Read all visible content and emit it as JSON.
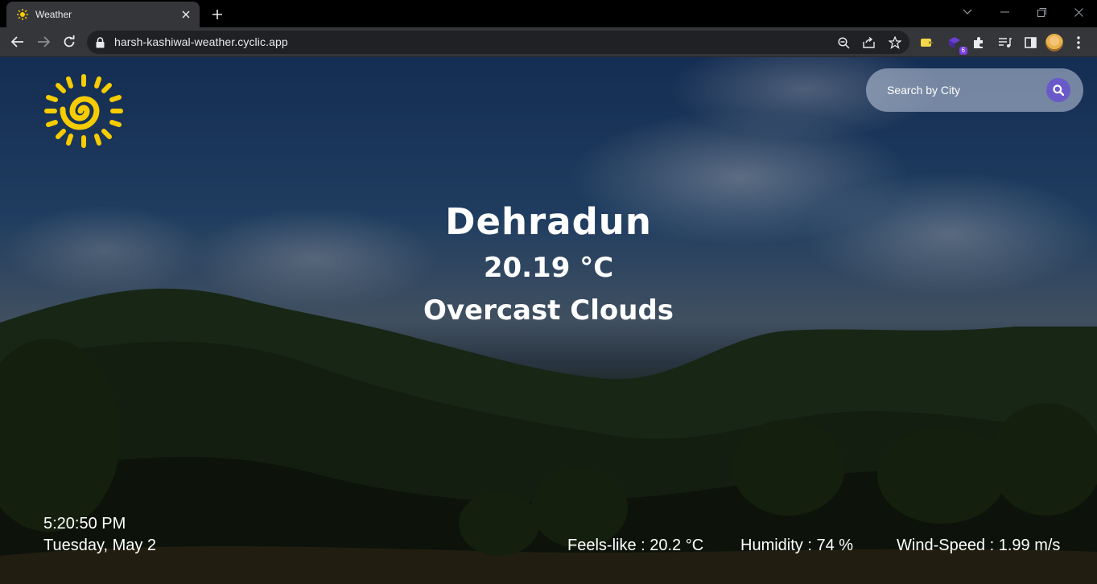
{
  "browser": {
    "tab_title": "Weather",
    "url": "harsh-kashiwal-weather.cyclic.app",
    "extension_badge": "6"
  },
  "header": {
    "search_placeholder": "Search by City"
  },
  "weather": {
    "city": "Dehradun",
    "temperature": "20.19 °C",
    "description": "Overcast Clouds"
  },
  "clock": {
    "time": "5:20:50 PM",
    "date": "Tuesday, May 2"
  },
  "details": {
    "feels_like": "Feels-like : 20.2 °C",
    "humidity": "Humidity : 74 %",
    "wind_speed": "Wind-Speed : 1.99 m/s"
  },
  "colors": {
    "sun": "#f7cc00",
    "search_button": "#6a5ac9",
    "chrome_bg": "#35363a"
  }
}
